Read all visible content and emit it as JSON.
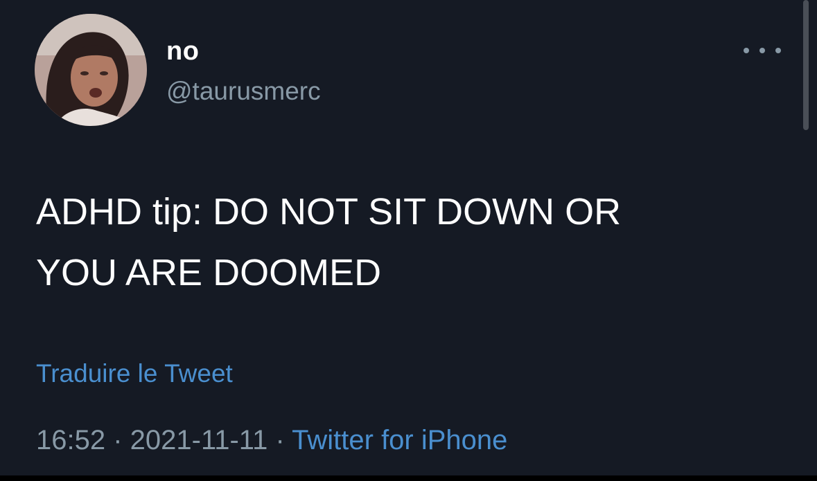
{
  "user": {
    "display_name": "no",
    "handle": "@taurusmerc"
  },
  "tweet": {
    "text_line1": "ADHD tip: DO NOT SIT DOWN OR",
    "text_line2": "YOU ARE DOOMED",
    "translate_label": "Traduire le Tweet"
  },
  "meta": {
    "time": "16:52",
    "separator": " · ",
    "date": "2021-11-11",
    "source": "Twitter for iPhone"
  },
  "icons": {
    "more": "more-horizontal-icon"
  },
  "colors": {
    "background": "#151a24",
    "text": "#ffffff",
    "secondary": "#8899a6",
    "link": "#4a8fcf"
  }
}
